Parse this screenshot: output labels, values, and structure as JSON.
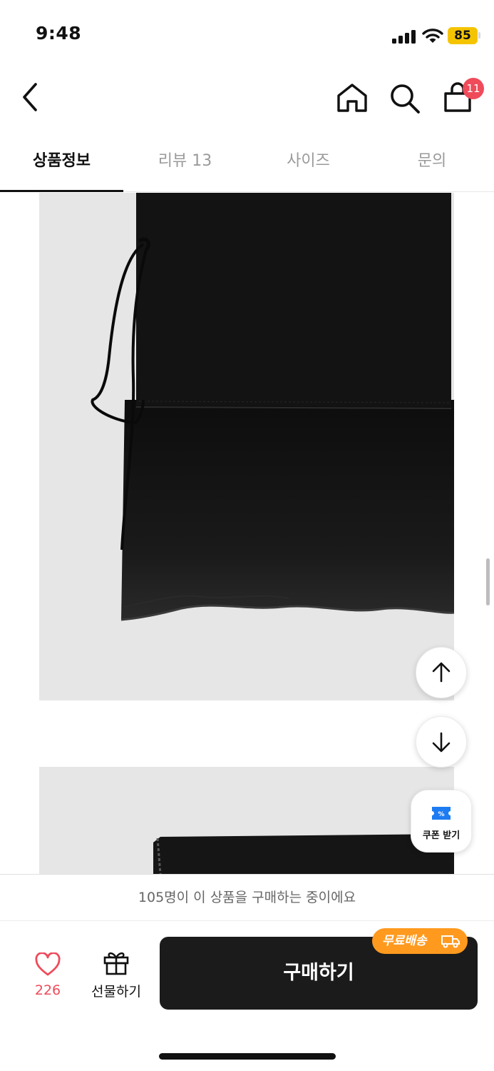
{
  "status_bar": {
    "time": "9:48",
    "battery": "85"
  },
  "header": {
    "back_icon": "chevron-left-icon",
    "home_icon": "home-icon",
    "search_icon": "search-icon",
    "cart_icon": "shopping-bag-icon",
    "cart_count": "11"
  },
  "tabs": [
    {
      "label": "상품정보",
      "active": true
    },
    {
      "label": "리뷰 13",
      "active": false
    },
    {
      "label": "사이즈",
      "active": false
    },
    {
      "label": "문의",
      "active": false
    }
  ],
  "floating": {
    "scroll_up_icon": "arrow-up-icon",
    "scroll_down_icon": "arrow-down-icon",
    "coupon_icon": "coupon-ticket-icon",
    "coupon_label": "쿠폰 받기"
  },
  "purchase_notice": "105명이 이 상품을 구매하는 중이에요",
  "bottom_bar": {
    "like_icon": "heart-icon",
    "like_count": "226",
    "gift_icon": "gift-icon",
    "gift_label": "선물하기",
    "buy_label": "구매하기",
    "shipping_badge": "무료배송",
    "shipping_icon": "truck-icon"
  },
  "colors": {
    "accent_red": "#ef4b5a",
    "shipping_orange": "#ff9a1f",
    "buy_button": "#1b1b1b",
    "battery_yellow": "#f5c400"
  }
}
